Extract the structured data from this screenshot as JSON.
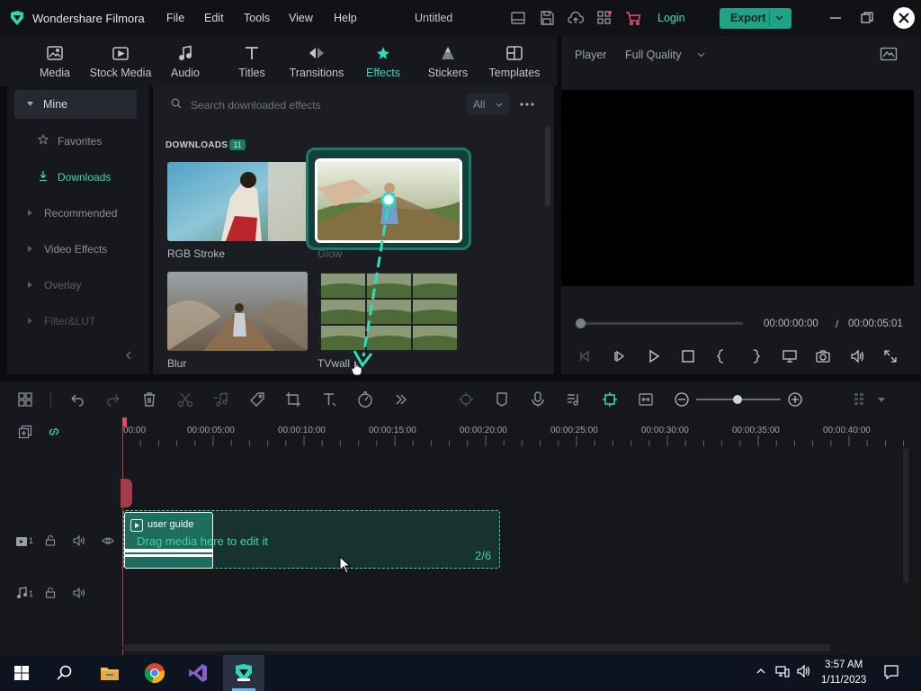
{
  "app": {
    "name": "Wondershare Filmora",
    "document_title": "Untitled"
  },
  "menu": [
    "File",
    "Edit",
    "Tools",
    "View",
    "Help"
  ],
  "titlebar": {
    "login_label": "Login",
    "export_label": "Export"
  },
  "media_tabs": [
    {
      "label": "Media",
      "icon": "media-icon"
    },
    {
      "label": "Stock Media",
      "icon": "stock-media-icon"
    },
    {
      "label": "Audio",
      "icon": "audio-icon"
    },
    {
      "label": "Titles",
      "icon": "titles-icon"
    },
    {
      "label": "Transitions",
      "icon": "transitions-icon"
    },
    {
      "label": "Effects",
      "icon": "effects-icon",
      "active": true
    },
    {
      "label": "Stickers",
      "icon": "stickers-icon"
    },
    {
      "label": "Templates",
      "icon": "templates-icon"
    }
  ],
  "sidebar": {
    "mine": "Mine",
    "favorites": "Favorites",
    "downloads": "Downloads",
    "categories": [
      "Recommended",
      "Video Effects",
      "Overlay",
      "Filter&LUT"
    ]
  },
  "effects": {
    "search_placeholder": "Search downloaded effects",
    "filter_value": "All",
    "section_heading": "DOWNLOADS",
    "section_count": "11",
    "items": [
      "RGB Stroke",
      "Glow",
      "Blur",
      "TVwall"
    ]
  },
  "player": {
    "label": "Player",
    "quality": "Full Quality",
    "current_time": "00:00:00:00",
    "separator": "/",
    "total_time": "00:00:05:01"
  },
  "timeline": {
    "ticks": [
      "00:00",
      "00:00:05:00",
      "00:00:10:00",
      "00:00:15:00",
      "00:00:20:00",
      "00:00:25:00",
      "00:00:30:00",
      "00:00:35:00",
      "00:00:40:00"
    ],
    "video_track_number": "1",
    "audio_track_number": "1",
    "clip_title": "user guide",
    "drop_hint": "Drag media here to edit it",
    "guide_step": "2/6"
  },
  "taskbar": {
    "time": "3:57 AM",
    "date": "1/11/2023"
  },
  "colors": {
    "accent": "#2fdcbb",
    "export_button": "#1fa386",
    "playhead": "#e04a62"
  }
}
